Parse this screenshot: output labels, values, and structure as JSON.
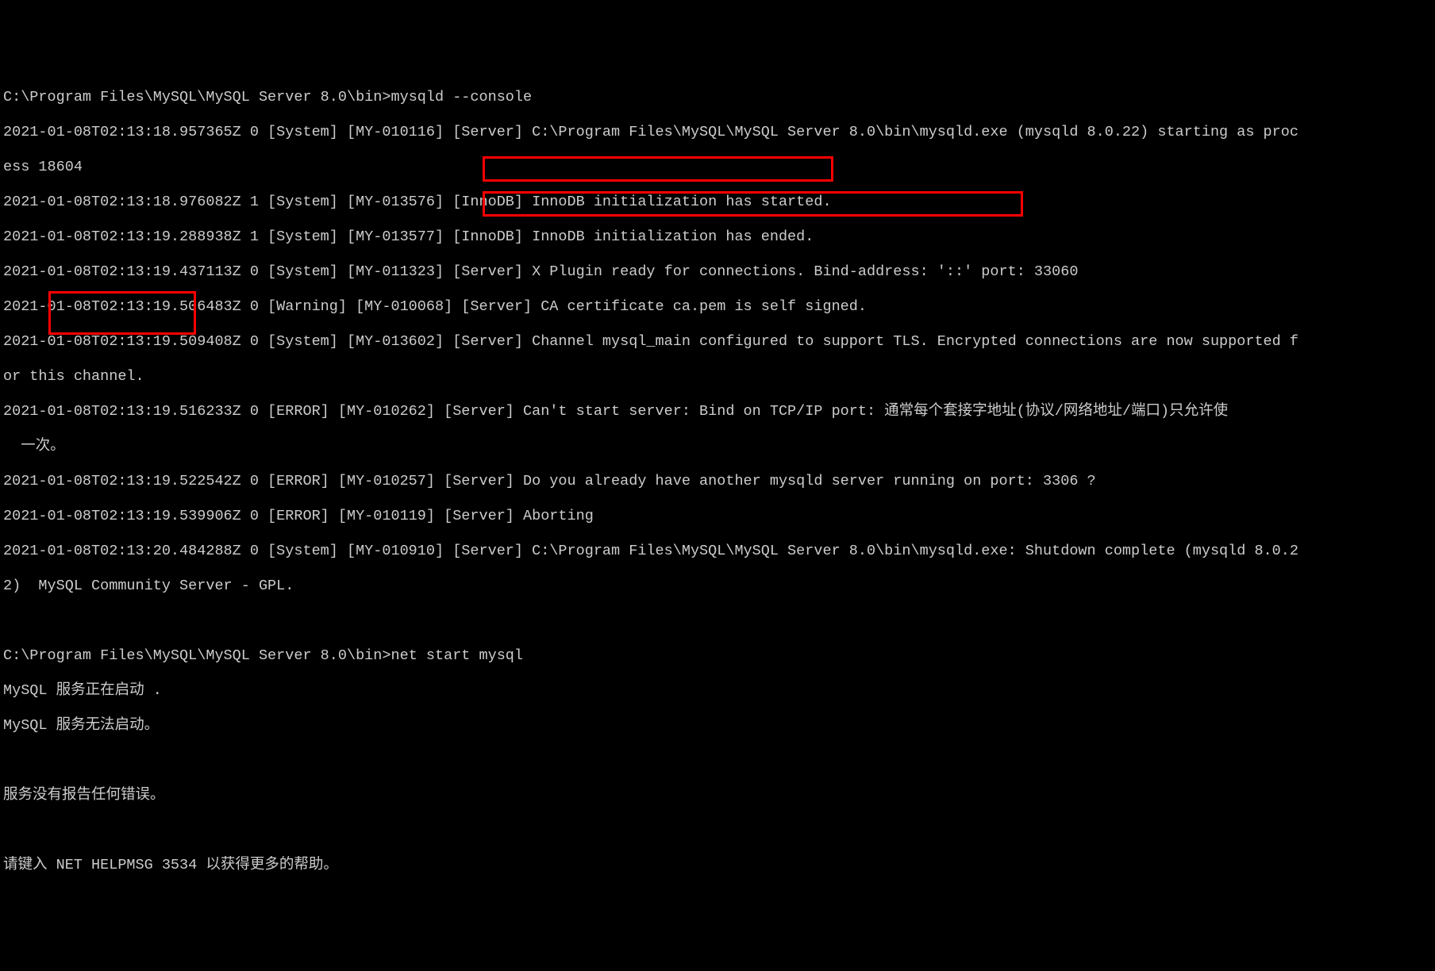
{
  "terminal": {
    "prompt1": "C:\\Program Files\\MySQL\\MySQL Server 8.0\\bin>",
    "cmd1": "mysqld --console",
    "lines": {
      "l1a": "2021-01-08T02:13:18.957365Z 0 [System] [MY-010116] [Server] C:\\Program Files\\MySQL\\MySQL Server 8.0\\bin\\mysqld.exe (mysqld 8.0.22) starting as proc",
      "l1b": "ess 18604",
      "l2": "2021-01-08T02:13:18.976082Z 1 [System] [MY-013576] [InnoDB] InnoDB initialization has started.",
      "l3": "2021-01-08T02:13:19.288938Z 1 [System] [MY-013577] [InnoDB] InnoDB initialization has ended.",
      "l4": "2021-01-08T02:13:19.437113Z 0 [System] [MY-011323] [Server] X Plugin ready for connections. Bind-address: '::' port: 33060",
      "l5": "2021-01-08T02:13:19.506483Z 0 [Warning] [MY-010068] [Server] CA certificate ca.pem is self signed.",
      "l6a": "2021-01-08T02:13:19.509408Z 0 [System] [MY-013602] [Server] Channel mysql_main configured to support TLS. Encrypted connections are now supported f",
      "l6b": "or this channel.",
      "l7a": "2021-01-08T02:13:19.516233Z 0 [ERROR] [MY-010262] [Server] Can't start server: Bind on TCP/IP port: 通常每个套接字地址(协议/网络地址/端口)只允许使",
      "l7b": "  一次。",
      "l8": "2021-01-08T02:13:19.522542Z 0 [ERROR] [MY-010257] [Server] Do you already have another mysqld server running on port: 3306 ?",
      "l9": "2021-01-08T02:13:19.539906Z 0 [ERROR] [MY-010119] [Server] Aborting",
      "l10a": "2021-01-08T02:13:20.484288Z 0 [System] [MY-010910] [Server] C:\\Program Files\\MySQL\\MySQL Server 8.0\\bin\\mysqld.exe: Shutdown complete (mysqld 8.0.2",
      "l10b": "2)  MySQL Community Server - GPL."
    },
    "prompt2": "C:\\Program Files\\MySQL\\MySQL Server 8.0\\bin>",
    "cmd2": "net start mysql",
    "svc1": "MySQL 服务正在启动 .",
    "svc2": "MySQL 服务无法启动。",
    "noerr": "服务没有报告任何错误。",
    "help": "请键入 NET HELPMSG 3534 以获得更多的帮助。"
  },
  "highlights": {
    "box1": {
      "desc": "Can't start server: Bind on TCP/IP port:"
    },
    "box2": {
      "desc": "Do you already have another mysqld server running on port: 3306 ?"
    },
    "box3": {
      "desc": "服务正在启动 / 服务无法启动"
    }
  }
}
